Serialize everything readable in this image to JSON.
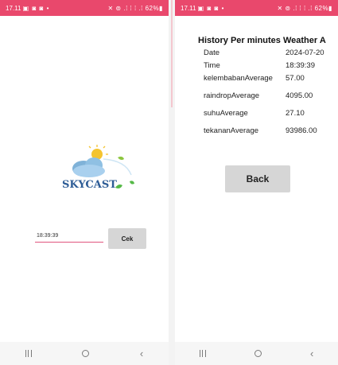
{
  "colors": {
    "status_bar": "#e9486c",
    "button_bg": "#d6d6d6",
    "input_underline": "#e0557e"
  },
  "left": {
    "status": {
      "time": "17.11",
      "icons": "▣ ◙ ◙ •",
      "right": "✕ ⊚ .⁞ ⁞ ⁞ .⁞ 62%▮"
    },
    "logo_text": "SKYCAST",
    "input_value": "18:39:39",
    "button_label": "Cek"
  },
  "right": {
    "status": {
      "time": "17.11",
      "icons": "▣ ◙ ◙ •",
      "right": "✕ ⊚ .⁞ ⁞ ⁞ .⁞ 62%▮"
    },
    "title": "History Per minutes Weather A",
    "rows": [
      {
        "label": "Date",
        "value": "2024-07-20"
      },
      {
        "label": "Time",
        "value": "18:39:39"
      },
      {
        "label": "kelembabanAverage",
        "value": "57.00"
      },
      {
        "label": "raindropAverage",
        "value": "4095.00"
      },
      {
        "label": "suhuAverage",
        "value": "27.10"
      },
      {
        "label": "tekananAverage",
        "value": "93986.00"
      }
    ],
    "button_label": "Back"
  }
}
